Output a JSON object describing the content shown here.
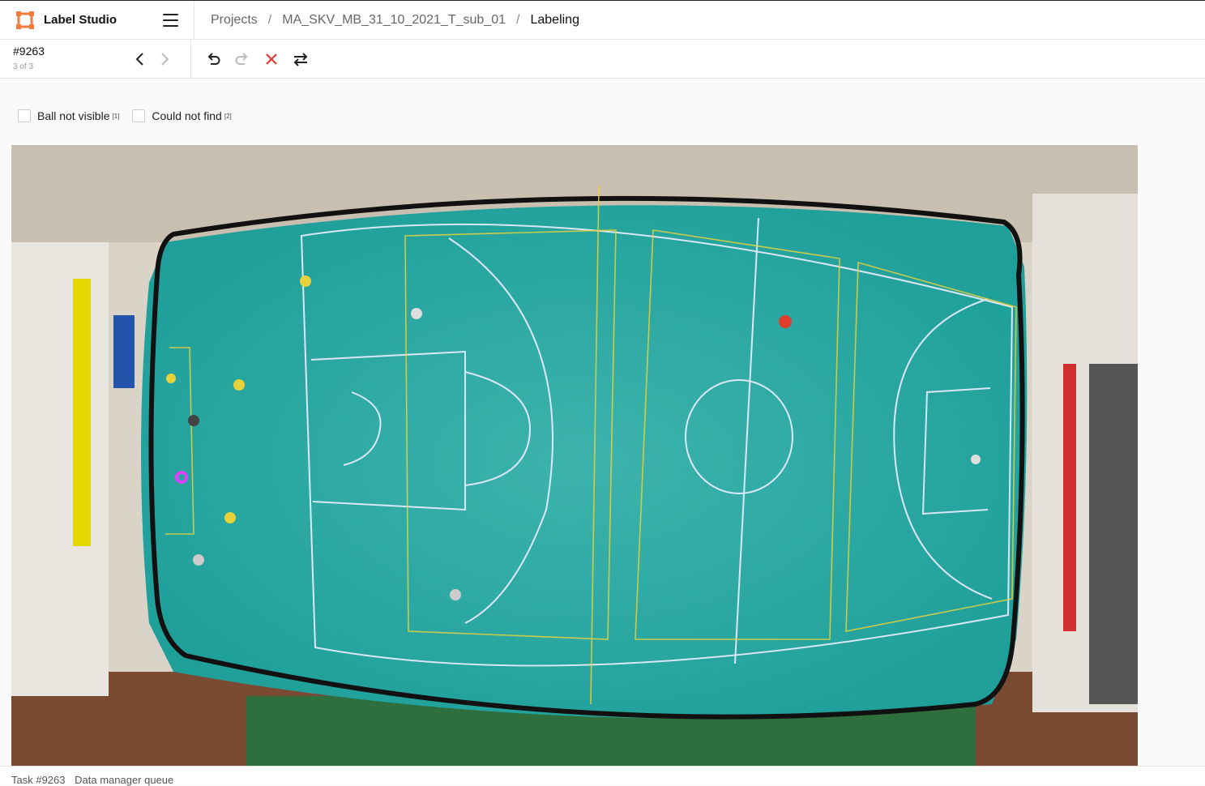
{
  "app": {
    "name": "Label Studio",
    "logo_color": "#f07d3b"
  },
  "breadcrumb": {
    "items": [
      "Projects",
      "MA_SKV_MB_31_10_2021_T_sub_01",
      "Labeling"
    ],
    "separator": "/"
  },
  "task": {
    "id": "#9263",
    "position": "3 of 3"
  },
  "toolbar": {
    "icons": [
      "undo-icon",
      "redo-icon",
      "reset-icon",
      "swap-icon"
    ],
    "reset_color": "#e53935"
  },
  "choices": [
    {
      "label": "Ball not visible",
      "hotkey": "[1]",
      "checked": false
    },
    {
      "label": "Could not find",
      "hotkey": "[2]",
      "checked": false
    }
  ],
  "annotation": {
    "keypoint_color": "#e040fb"
  },
  "footer": {
    "task_label": "Task #9263",
    "queue_label": "Data manager queue"
  }
}
